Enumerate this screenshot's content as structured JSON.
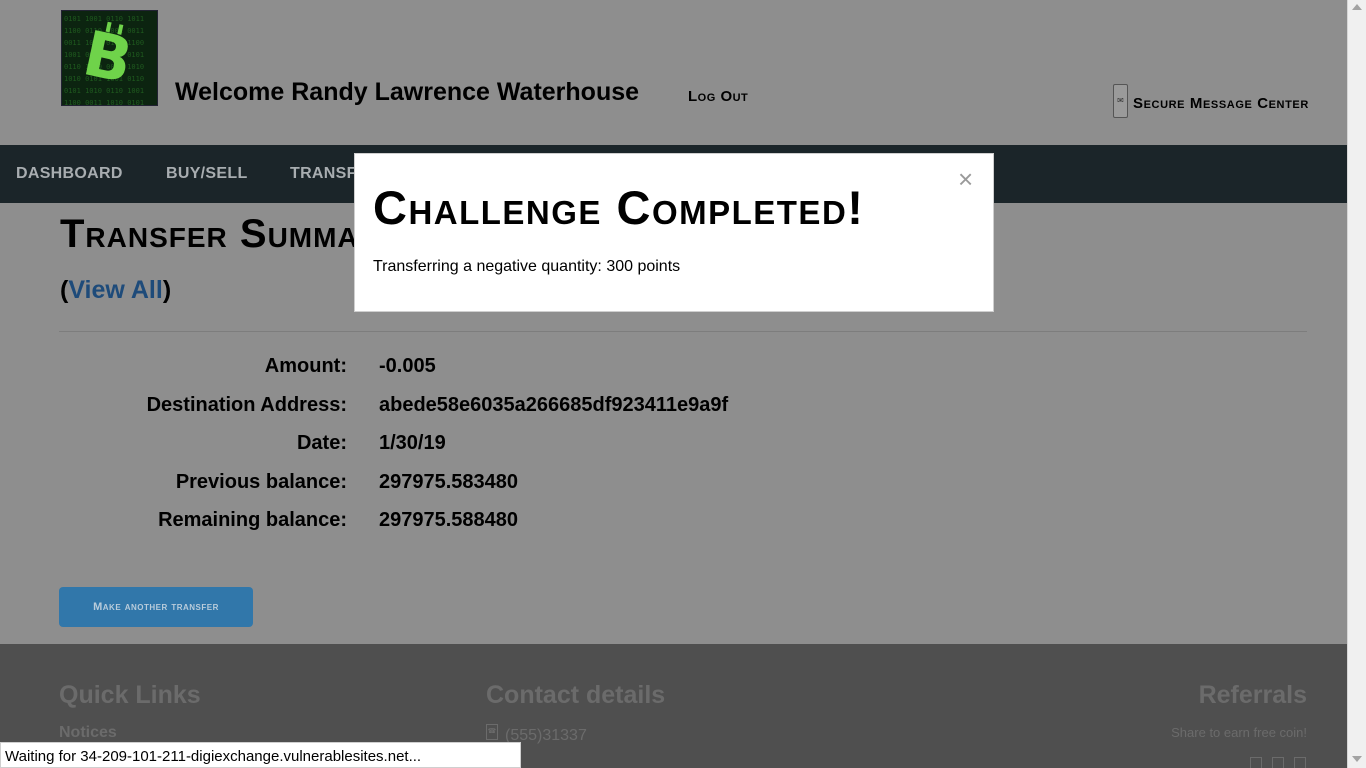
{
  "header": {
    "welcome": "Welcome Randy Lawrence Waterhouse",
    "logout": "Log Out",
    "message_center": "Secure Message Center",
    "message_icon": "envelope-icon",
    "logo_icon": "bitcoin-logo"
  },
  "nav": {
    "items": [
      "DASHBOARD",
      "BUY/SELL",
      "TRANSFER"
    ]
  },
  "main": {
    "title": "Transfer Summary",
    "view_all_open": "(",
    "view_all": "View All",
    "view_all_close": ")",
    "fields": [
      {
        "label": "Amount:",
        "value": "-0.005"
      },
      {
        "label": "Destination Address:",
        "value": "abede58e6035a266685df923411e9a9f"
      },
      {
        "label": "Date:",
        "value": "1/30/19"
      },
      {
        "label": "Previous balance:",
        "value": "297975.583480"
      },
      {
        "label": "Remaining balance:",
        "value": "297975.588480"
      }
    ],
    "button": "Make another transfer"
  },
  "footer": {
    "quick_links": "Quick Links",
    "notices": "Notices",
    "contact": "Contact details",
    "phone": "(555)31337",
    "referrals": "Referrals",
    "share": "Share to earn free coin!"
  },
  "modal": {
    "title": "Challenge Completed!",
    "close": "×",
    "text": "Transferring a negative quantity: 300 points"
  },
  "statusbar": {
    "text": "Waiting for 34-209-101-211-digiexchange.vulnerablesites.net..."
  },
  "colors": {
    "nav_bg": "#1b2529",
    "link": "#1e4b7a",
    "button": "#3177aa",
    "footer_bg": "#4f4f4f"
  }
}
